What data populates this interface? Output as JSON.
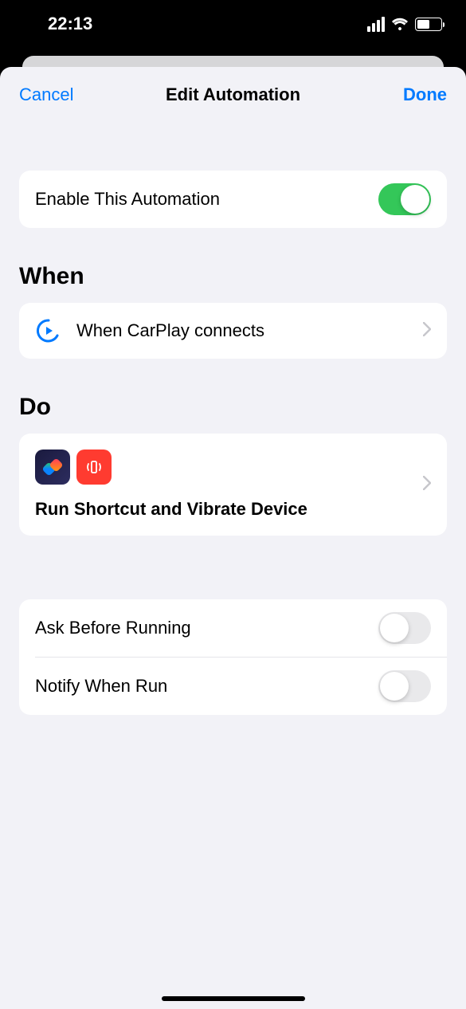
{
  "status": {
    "time": "22:13"
  },
  "nav": {
    "cancel": "Cancel",
    "title": "Edit Automation",
    "done": "Done"
  },
  "enable": {
    "label": "Enable This Automation",
    "value": true
  },
  "sections": {
    "when": "When",
    "do": "Do"
  },
  "when": {
    "trigger": "When CarPlay connects"
  },
  "do": {
    "actions": "Run Shortcut and Vibrate Device"
  },
  "settings": {
    "ask": {
      "label": "Ask Before Running",
      "value": false
    },
    "notify": {
      "label": "Notify When Run",
      "value": false
    }
  }
}
